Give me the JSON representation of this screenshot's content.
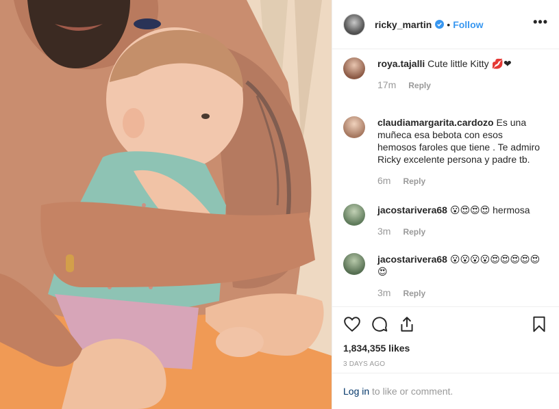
{
  "post": {
    "username": "ricky_martin",
    "verified": true,
    "separator": "•",
    "follow_label": "Follow",
    "more_label": "•••"
  },
  "comments": [
    {
      "user": "roya.tajalli",
      "text": "Cute little Kitty 💋❤",
      "time": "17m",
      "reply_label": "Reply",
      "avatar_color": "#b68b73"
    },
    {
      "user": "claudiamargarita.cardozo",
      "text": "Es una muñeca esa bebota con esos hemosos faroles que tiene . Te admiro Ricky excelente persona y padre tb.",
      "time": "6m",
      "reply_label": "Reply",
      "avatar_color": "#c7a38a"
    },
    {
      "user": "jacostarivera68",
      "text": "😮😍😍😍 hermosa",
      "time": "3m",
      "reply_label": "Reply",
      "avatar_color": "#8aa486"
    },
    {
      "user": "jacostarivera68",
      "text": "😮😮😮😮😍😍😍😍😍😍",
      "time": "3m",
      "reply_label": "Reply",
      "avatar_color": "#7c9a7a"
    }
  ],
  "actions": {
    "like_icon": "heart-icon",
    "comment_icon": "comment-icon",
    "share_icon": "share-icon",
    "save_icon": "bookmark-icon"
  },
  "likes": "1,834,355 likes",
  "date": "3 DAYS AGO",
  "login": {
    "link": "Log in",
    "rest": " to like or comment."
  },
  "colors": {
    "accent": "#3897f0",
    "link_dark": "#003569",
    "muted": "#999999",
    "border": "#efefef"
  }
}
